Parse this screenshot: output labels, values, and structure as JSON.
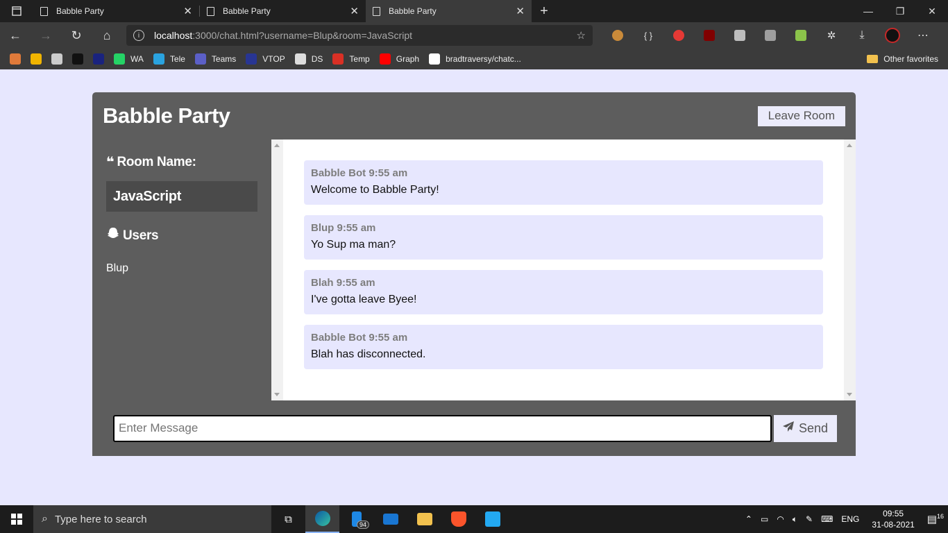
{
  "browser": {
    "tabs": [
      {
        "title": "Babble Party"
      },
      {
        "title": "Babble Party"
      },
      {
        "title": "Babble Party"
      }
    ],
    "address": {
      "host": "localhost",
      "rest": ":3000/chat.html?username=Blup&room=JavaScript"
    },
    "bookmarks": [
      {
        "label": "",
        "icon": "swirl-icon",
        "color": "#e07a3a"
      },
      {
        "label": "",
        "icon": "bar-chart-icon",
        "color": "#f0b400"
      },
      {
        "label": "",
        "icon": "cc-icon",
        "color": "#cccccc"
      },
      {
        "label": "",
        "icon": "hackerrank-icon",
        "color": "#111111"
      },
      {
        "label": "",
        "icon": "blue-square-icon",
        "color": "#1a237e"
      },
      {
        "label": "WA",
        "icon": "whatsapp-icon",
        "color": "#25d366"
      },
      {
        "label": "Tele",
        "icon": "telegram-icon",
        "color": "#2aa3e0"
      },
      {
        "label": "Teams",
        "icon": "teams-icon",
        "color": "#5b5fc7"
      },
      {
        "label": "VTOP",
        "icon": "vtop-icon",
        "color": "#283593"
      },
      {
        "label": "DS",
        "icon": "page-icon",
        "color": "#dddddd"
      },
      {
        "label": "Temp",
        "icon": "gmail-icon",
        "color": "#d93025"
      },
      {
        "label": "Graph",
        "icon": "youtube-icon",
        "color": "#ff0000"
      },
      {
        "label": "bradtraversy/chatc...",
        "icon": "github-icon",
        "color": "#ffffff"
      }
    ],
    "other_favorites": "Other favorites"
  },
  "app": {
    "title": "Babble Party",
    "leave_label": "Leave Room",
    "room_heading": "Room Name:",
    "room_name": "JavaScript",
    "users_heading": "Users",
    "users": [
      "Blup"
    ],
    "messages": [
      {
        "user": "Babble Bot",
        "time": "9:55 am",
        "text": "Welcome to Babble Party!"
      },
      {
        "user": "Blup",
        "time": "9:55 am",
        "text": "Yo Sup ma man?"
      },
      {
        "user": "Blah",
        "time": "9:55 am",
        "text": "I've gotta leave Byee!"
      },
      {
        "user": "Babble Bot",
        "time": "9:55 am",
        "text": "Blah has disconnected."
      }
    ],
    "input_placeholder": "Enter Message",
    "send_label": "Send"
  },
  "taskbar": {
    "search_placeholder": "Type here to search",
    "badge": "94",
    "lang": "ENG",
    "time": "09:55",
    "date": "31-08-2021",
    "notifications": "16"
  }
}
